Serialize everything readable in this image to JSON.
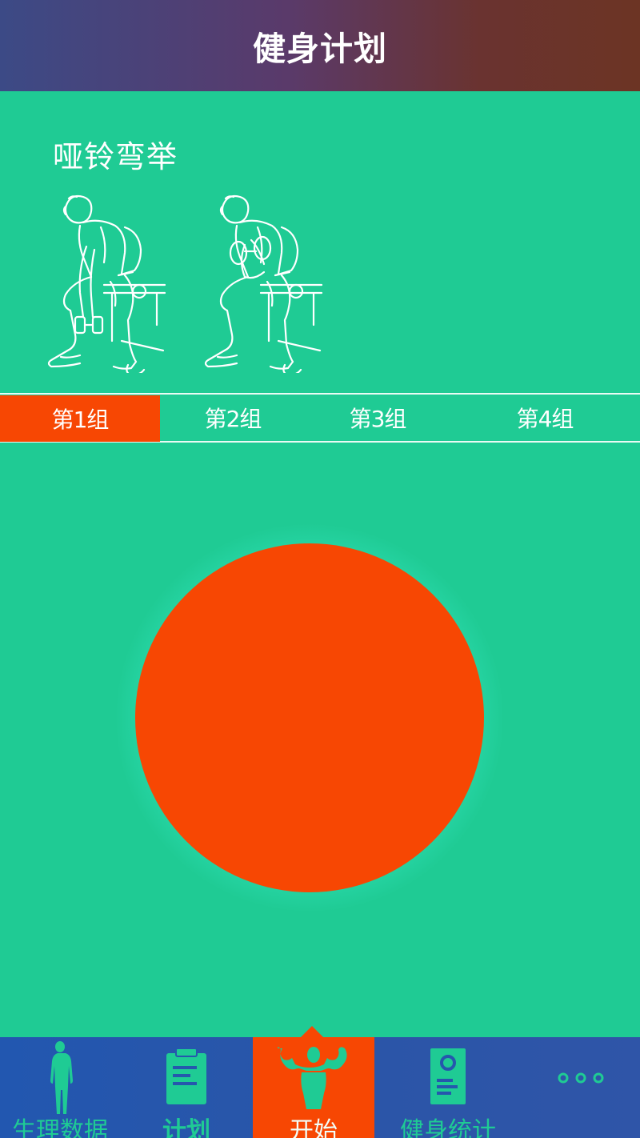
{
  "header": {
    "title": "健身计划"
  },
  "exercise": {
    "name": "哑铃弯举",
    "figures": [
      "dumbbell-curl-down-icon",
      "dumbbell-curl-up-icon"
    ]
  },
  "sets": {
    "tabs": [
      {
        "label": "第1组",
        "active": true
      },
      {
        "label": "第2组",
        "active": false
      },
      {
        "label": "第3组",
        "active": false
      },
      {
        "label": "第4组",
        "active": false
      }
    ]
  },
  "start_button": {
    "color": "#f74703"
  },
  "bottom_nav": {
    "items": [
      {
        "label": "生理数据",
        "icon": "body-silhouette-icon"
      },
      {
        "label": "计划",
        "icon": "clipboard-icon"
      },
      {
        "label": "开始",
        "icon": "bodybuilder-icon",
        "active": true
      },
      {
        "label": "健身统计",
        "icon": "report-icon"
      },
      {
        "label": "",
        "icon": "more-dots-icon"
      }
    ]
  },
  "colors": {
    "background": "#1fcb94",
    "accent": "#f74703",
    "nav_background": "#2257b0"
  }
}
